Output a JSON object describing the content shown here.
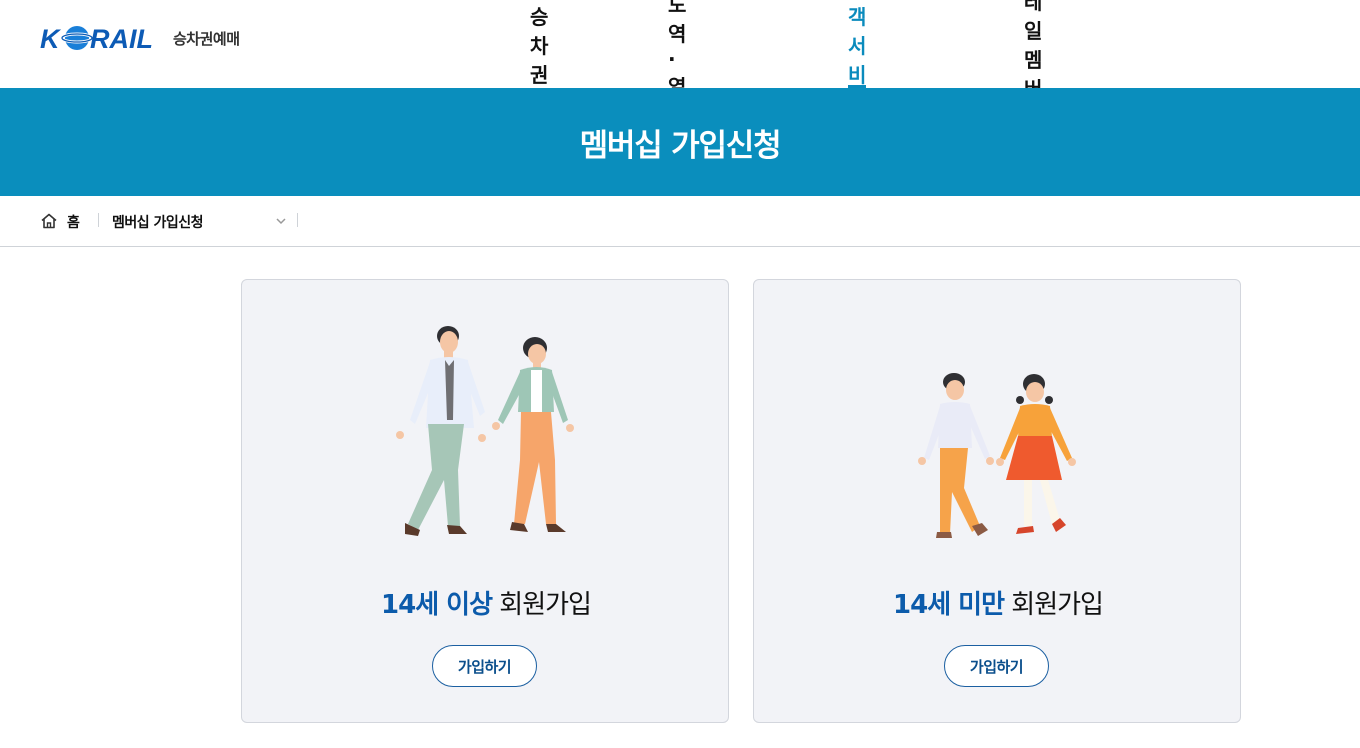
{
  "header": {
    "logo_sub": "승차권예매",
    "nav": [
      {
        "label": "승차권",
        "active": false
      },
      {
        "label": "철도역·열차",
        "active": false
      },
      {
        "label": "고객서비스",
        "active": true
      },
      {
        "label": "코레일멤버십",
        "active": false
      }
    ]
  },
  "banner": {
    "title": "멤버십 가입신청"
  },
  "breadcrumb": {
    "home": "홈",
    "current": "멤버십 가입신청"
  },
  "cards": [
    {
      "title_em": "14세 이상",
      "title_rest": " 회원가입",
      "button": "가입하기"
    },
    {
      "title_em": "14세 미만",
      "title_rest": " 회원가입",
      "button": "가입하기"
    }
  ],
  "colors": {
    "accent": "#0a8bbd",
    "banner": "#0a8ebd",
    "brand_blue": "#0c5bab",
    "card_bg": "#f2f3f7"
  },
  "icons": [
    "korail-logo",
    "home-icon",
    "chevron-down-icon"
  ]
}
